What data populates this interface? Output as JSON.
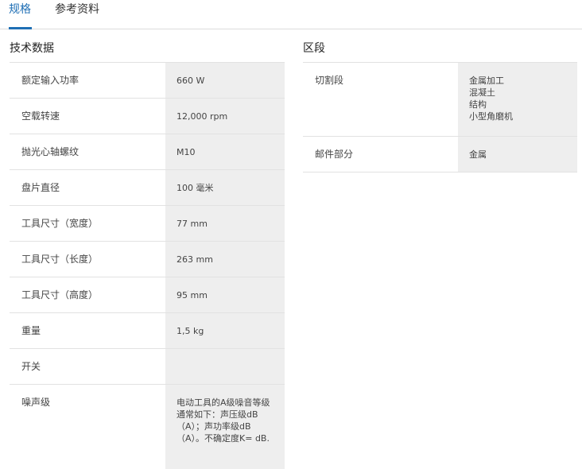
{
  "tabs": [
    {
      "label": "规格",
      "active": true
    },
    {
      "label": "参考资料",
      "active": false
    }
  ],
  "accent_color": "#1f6fb5",
  "tech_section": {
    "title": "技术数据",
    "rows": [
      {
        "label": "额定输入功率",
        "value": "660 W"
      },
      {
        "label": "空载转速",
        "value": "12,000 rpm"
      },
      {
        "label": "抛光心轴螺纹",
        "value": "M10"
      },
      {
        "label": "盘片直径",
        "value": "100 毫米"
      },
      {
        "label": "工具尺寸（宽度）",
        "value": "77 mm"
      },
      {
        "label": "工具尺寸（长度）",
        "value": "263 mm"
      },
      {
        "label": "工具尺寸（高度）",
        "value": "95 mm"
      },
      {
        "label": "重量",
        "value": "1,5 kg"
      },
      {
        "label": "开关",
        "value": ""
      },
      {
        "label": "噪声级",
        "value": "电动工具的A级噪音等级通常如下：声压级dB（A）；声功率级dB（A）。不确定度K= dB."
      }
    ]
  },
  "segment_section": {
    "title": "区段",
    "rows": [
      {
        "label": "切割段",
        "values": [
          "金属加工",
          "混凝土",
          "结构",
          "小型角磨机"
        ]
      },
      {
        "label": "邮件部分",
        "values": [
          "金属"
        ]
      }
    ]
  }
}
